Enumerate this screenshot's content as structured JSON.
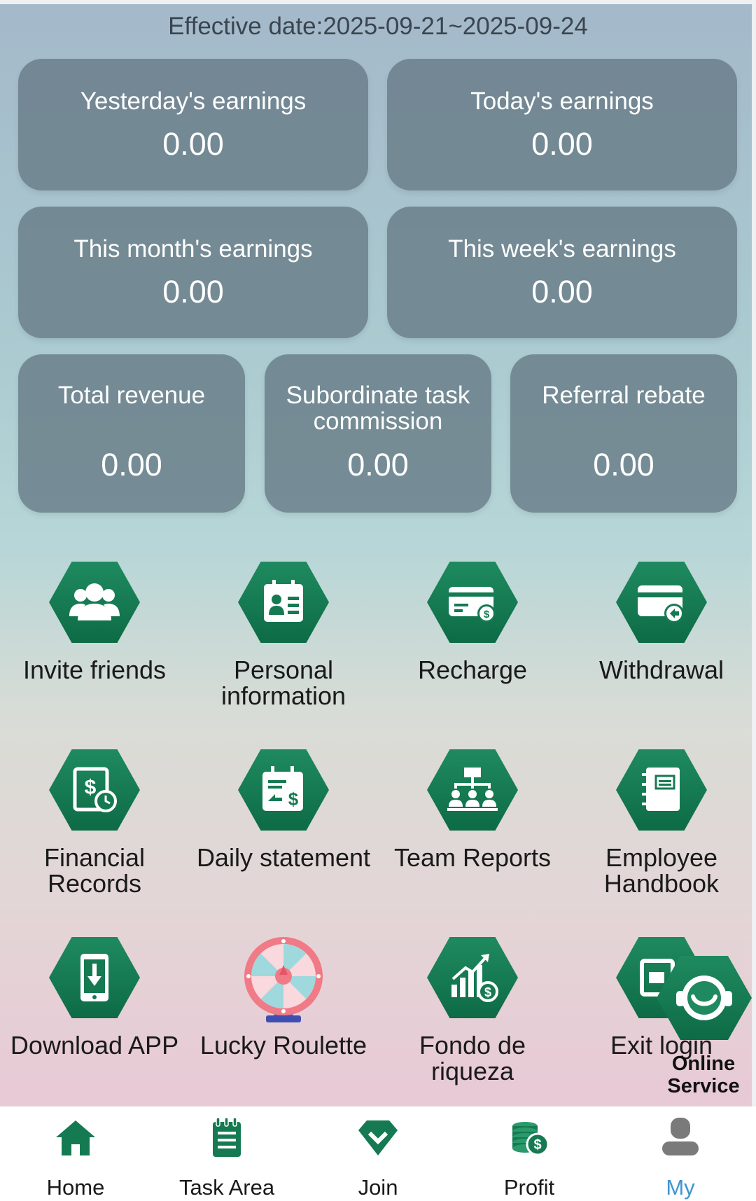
{
  "header": {
    "effective_date": "Effective date:2025-09-21~2025-09-24"
  },
  "earnings": {
    "yesterday": {
      "label": "Yesterday's earnings",
      "value": "0.00"
    },
    "today": {
      "label": "Today's earnings",
      "value": "0.00"
    },
    "month": {
      "label": "This month's earnings",
      "value": "0.00"
    },
    "week": {
      "label": "This week's earnings",
      "value": "0.00"
    },
    "total": {
      "label": "Total revenue",
      "value": "0.00"
    },
    "subordinate": {
      "label": "Subordinate task commission",
      "value": "0.00"
    },
    "referral": {
      "label": "Referral rebate",
      "value": "0.00"
    }
  },
  "menu": [
    {
      "label": "Invite friends",
      "icon": "users-icon"
    },
    {
      "label": "Personal information",
      "icon": "id-card-icon"
    },
    {
      "label": "Recharge",
      "icon": "credit-card-dollar-icon"
    },
    {
      "label": "Withdrawal",
      "icon": "card-withdraw-icon"
    },
    {
      "label": "Financial Records",
      "icon": "dollar-clock-icon"
    },
    {
      "label": "Daily statement",
      "icon": "calendar-dollar-icon"
    },
    {
      "label": "Team Reports",
      "icon": "org-chart-icon"
    },
    {
      "label": "Employee Handbook",
      "icon": "notebook-icon"
    },
    {
      "label": "Download APP",
      "icon": "phone-download-icon"
    },
    {
      "label": "Lucky Roulette",
      "icon": "roulette-wheel-icon"
    },
    {
      "label": "Fondo de riqueza",
      "icon": "growth-chart-icon"
    },
    {
      "label": "Exit login",
      "icon": "logout-icon"
    }
  ],
  "online_service": {
    "label": "Online Service",
    "icon": "headset-agent-icon"
  },
  "nav": [
    {
      "label": "Home",
      "icon": "home-icon"
    },
    {
      "label": "Task Area",
      "icon": "notepad-icon"
    },
    {
      "label": "Join",
      "icon": "shield-check-icon"
    },
    {
      "label": "Profit",
      "icon": "coins-icon"
    },
    {
      "label": "My",
      "icon": "user-icon",
      "active": true
    }
  ],
  "colors": {
    "accent_green": "#157a52",
    "active_blue": "#3f95d1",
    "card_bg": "#687d88"
  }
}
